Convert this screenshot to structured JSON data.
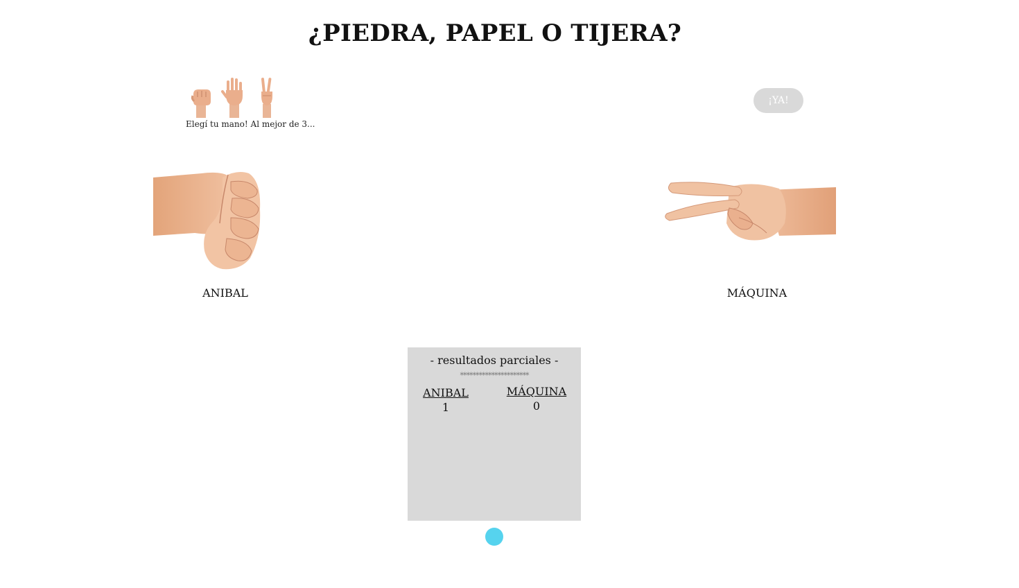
{
  "header": {
    "title": "¿PIEDRA, PAPEL O TIJERA?"
  },
  "picker": {
    "options": [
      {
        "icon": "rock-hand-icon"
      },
      {
        "icon": "paper-hand-icon"
      },
      {
        "icon": "scissors-hand-icon"
      }
    ],
    "hint": "Elegí tu mano! Al mejor de 3..."
  },
  "controls": {
    "go_label": "¡YA!",
    "go_color": "#d9d9d9",
    "round_dot_color": "#56d3ee"
  },
  "arena": {
    "player": {
      "name": "ANIBAL",
      "hand": "rock-hand-icon"
    },
    "machine": {
      "name": "MÁQUINA",
      "hand": "scissors-hand-icon"
    }
  },
  "results": {
    "title": "- resultados parciales -",
    "separator": "**********************",
    "player": {
      "name": "ANIBAL",
      "score": "1"
    },
    "machine": {
      "name": "MÁQUINA",
      "score": "0"
    }
  }
}
